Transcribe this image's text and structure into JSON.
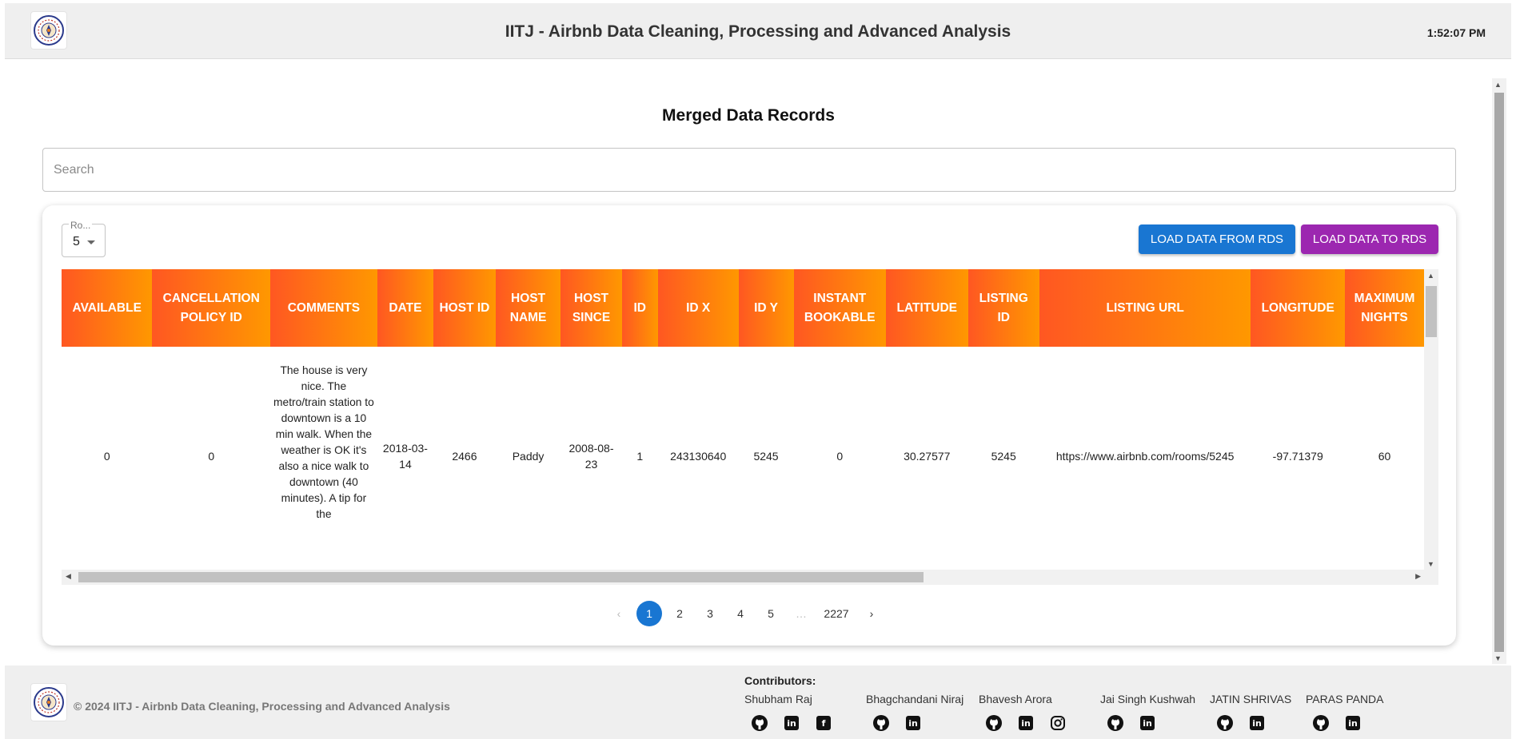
{
  "header": {
    "title": "IITJ - Airbnb Data Cleaning, Processing and Advanced Analysis",
    "time": "1:52:07 PM",
    "logo_icon": "institute-seal-icon"
  },
  "main": {
    "title": "Merged Data Records",
    "search": {
      "placeholder": "Search",
      "value": ""
    },
    "rows_per_page": {
      "label": "Ro...",
      "value": "5"
    },
    "buttons": {
      "load_from": "LOAD DATA FROM RDS",
      "load_to": "LOAD DATA TO RDS"
    },
    "colors": {
      "primary": "#1976d2",
      "secondary": "#9c27b0",
      "header_start": "#ff5722",
      "header_end": "#ff9800"
    }
  },
  "table": {
    "columns": [
      "AVAILABLE",
      "CANCELLATION POLICY ID",
      "COMMENTS",
      "DATE",
      "HOST ID",
      "HOST NAME",
      "HOST SINCE",
      "ID",
      "ID X",
      "ID Y",
      "INSTANT BOOKABLE",
      "LATITUDE",
      "LISTING ID",
      "LISTING URL",
      "LONGITUDE",
      "MAXIMUM NIGHTS"
    ],
    "rows": [
      [
        "0",
        "0",
        "The house is very nice. The metro/train station to downtown is a 10 min walk. When the weather is OK it's also a nice walk to downtown (40 minutes). A tip for the",
        "2018-03-14",
        "2466",
        "Paddy",
        "2008-08-23",
        "1",
        "243130640",
        "5245",
        "0",
        "30.27577",
        "5245",
        "https://www.airbnb.com/rooms/5245",
        "-97.71379",
        "60"
      ]
    ]
  },
  "pagination": {
    "prev": "‹",
    "pages": [
      "1",
      "2",
      "3",
      "4",
      "5"
    ],
    "ellipsis": "…",
    "last": "2227",
    "next": "›",
    "current": "1"
  },
  "footer": {
    "copyright": "© 2024 IITJ - Airbnb Data Cleaning, Processing and Advanced Analysis",
    "contributors_title": "Contributors:",
    "contributors": [
      {
        "name": "Shubham Raj",
        "icons": [
          "github-icon",
          "linkedin-icon",
          "facebook-icon"
        ]
      },
      {
        "name": "Bhagchandani Niraj",
        "icons": [
          "github-icon",
          "linkedin-icon"
        ]
      },
      {
        "name": "Bhavesh Arora",
        "icons": [
          "github-icon",
          "linkedin-icon",
          "instagram-icon"
        ]
      },
      {
        "name": "Jai Singh Kushwah",
        "icons": [
          "github-icon",
          "linkedin-icon"
        ]
      },
      {
        "name": "JATIN SHRIVAS",
        "icons": [
          "github-icon",
          "linkedin-icon"
        ]
      },
      {
        "name": "PARAS PANDA",
        "icons": [
          "github-icon",
          "linkedin-icon"
        ]
      }
    ]
  }
}
